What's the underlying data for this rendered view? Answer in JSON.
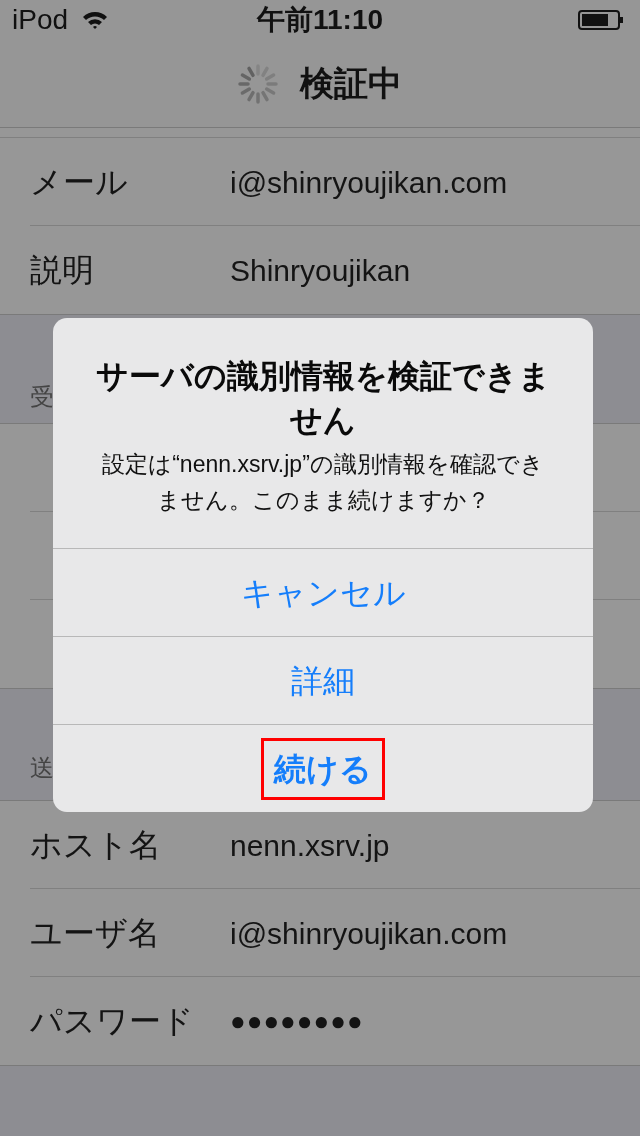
{
  "status_bar": {
    "device": "iPod",
    "time": "午前11:10"
  },
  "nav": {
    "title": "検証中"
  },
  "account_rows": [
    {
      "label": "メール",
      "value": "i@shinryoujikan.com"
    },
    {
      "label": "説明",
      "value": "Shinryoujikan"
    }
  ],
  "incoming": {
    "header": "受"
  },
  "outgoing": {
    "header": "送",
    "rows": [
      {
        "label": "ホスト名",
        "value": "nenn.xsrv.jp",
        "kind": "text"
      },
      {
        "label": "ユーザ名",
        "value": "i@shinryoujikan.com",
        "kind": "text"
      },
      {
        "label": "パスワード",
        "value": "●●●●●●●●",
        "kind": "password"
      }
    ]
  },
  "alert": {
    "title": "サーバの識別情報を検証できません",
    "message": "設定は“nenn.xsrv.jp”の識別情報を確認できません。このまま続けますか？",
    "actions": [
      {
        "label": "キャンセル",
        "bold": false,
        "highlighted": false
      },
      {
        "label": "詳細",
        "bold": false,
        "highlighted": false
      },
      {
        "label": "続ける",
        "bold": true,
        "highlighted": true
      }
    ]
  }
}
